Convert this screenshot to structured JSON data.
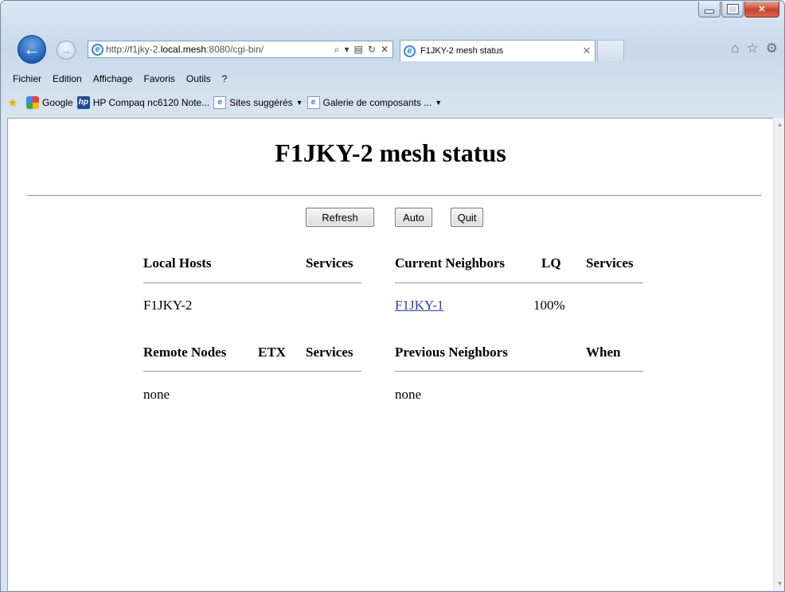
{
  "browser": {
    "url_prefix": "http://f1jky-2.",
    "url_host": "local.mesh",
    "url_suffix": ":8080/cgi-bin/",
    "tab_title": "F1JKY-2 mesh status",
    "menu": [
      "Fichier",
      "Edition",
      "Affichage",
      "Favoris",
      "Outils",
      "?"
    ],
    "favorites": [
      {
        "label": "Google",
        "icon": "google-icon"
      },
      {
        "label": "HP Compaq nc6120 Note...",
        "icon": "hp-icon"
      },
      {
        "label": "Sites suggérés",
        "icon": "ie-page-icon",
        "dropdown": true
      },
      {
        "label": "Galerie de composants ...",
        "icon": "ie-page-icon",
        "dropdown": true
      }
    ]
  },
  "page": {
    "title": "F1JKY-2 mesh status",
    "buttons": {
      "refresh": "Refresh",
      "auto": "Auto",
      "quit": "Quit"
    },
    "local_hosts": {
      "headers": {
        "name": "Local Hosts",
        "services": "Services"
      },
      "rows": [
        {
          "name": "F1JKY-2",
          "services": ""
        }
      ]
    },
    "current_neighbors": {
      "headers": {
        "name": "Current Neighbors",
        "lq": "LQ",
        "services": "Services"
      },
      "rows": [
        {
          "name": "F1JKY-1",
          "lq": "100%",
          "services": ""
        }
      ]
    },
    "remote_nodes": {
      "headers": {
        "name": "Remote Nodes",
        "etx": "ETX",
        "services": "Services"
      },
      "empty": "none"
    },
    "previous_neighbors": {
      "headers": {
        "name": "Previous Neighbors",
        "when": "When"
      },
      "empty": "none"
    }
  }
}
